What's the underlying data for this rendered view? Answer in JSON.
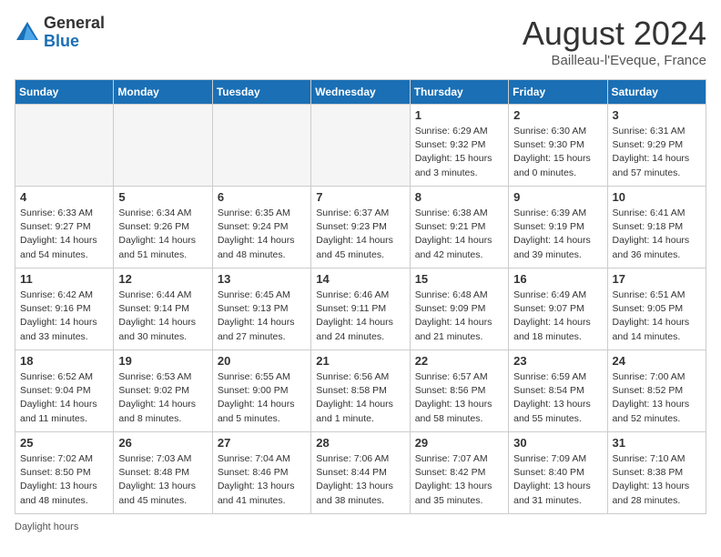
{
  "header": {
    "logo_general": "General",
    "logo_blue": "Blue",
    "month_year": "August 2024",
    "location": "Bailleau-l'Eveque, France"
  },
  "weekdays": [
    "Sunday",
    "Monday",
    "Tuesday",
    "Wednesday",
    "Thursday",
    "Friday",
    "Saturday"
  ],
  "weeks": [
    [
      {
        "day": "",
        "info": ""
      },
      {
        "day": "",
        "info": ""
      },
      {
        "day": "",
        "info": ""
      },
      {
        "day": "",
        "info": ""
      },
      {
        "day": "1",
        "info": "Sunrise: 6:29 AM\nSunset: 9:32 PM\nDaylight: 15 hours\nand 3 minutes."
      },
      {
        "day": "2",
        "info": "Sunrise: 6:30 AM\nSunset: 9:30 PM\nDaylight: 15 hours\nand 0 minutes."
      },
      {
        "day": "3",
        "info": "Sunrise: 6:31 AM\nSunset: 9:29 PM\nDaylight: 14 hours\nand 57 minutes."
      }
    ],
    [
      {
        "day": "4",
        "info": "Sunrise: 6:33 AM\nSunset: 9:27 PM\nDaylight: 14 hours\nand 54 minutes."
      },
      {
        "day": "5",
        "info": "Sunrise: 6:34 AM\nSunset: 9:26 PM\nDaylight: 14 hours\nand 51 minutes."
      },
      {
        "day": "6",
        "info": "Sunrise: 6:35 AM\nSunset: 9:24 PM\nDaylight: 14 hours\nand 48 minutes."
      },
      {
        "day": "7",
        "info": "Sunrise: 6:37 AM\nSunset: 9:23 PM\nDaylight: 14 hours\nand 45 minutes."
      },
      {
        "day": "8",
        "info": "Sunrise: 6:38 AM\nSunset: 9:21 PM\nDaylight: 14 hours\nand 42 minutes."
      },
      {
        "day": "9",
        "info": "Sunrise: 6:39 AM\nSunset: 9:19 PM\nDaylight: 14 hours\nand 39 minutes."
      },
      {
        "day": "10",
        "info": "Sunrise: 6:41 AM\nSunset: 9:18 PM\nDaylight: 14 hours\nand 36 minutes."
      }
    ],
    [
      {
        "day": "11",
        "info": "Sunrise: 6:42 AM\nSunset: 9:16 PM\nDaylight: 14 hours\nand 33 minutes."
      },
      {
        "day": "12",
        "info": "Sunrise: 6:44 AM\nSunset: 9:14 PM\nDaylight: 14 hours\nand 30 minutes."
      },
      {
        "day": "13",
        "info": "Sunrise: 6:45 AM\nSunset: 9:13 PM\nDaylight: 14 hours\nand 27 minutes."
      },
      {
        "day": "14",
        "info": "Sunrise: 6:46 AM\nSunset: 9:11 PM\nDaylight: 14 hours\nand 24 minutes."
      },
      {
        "day": "15",
        "info": "Sunrise: 6:48 AM\nSunset: 9:09 PM\nDaylight: 14 hours\nand 21 minutes."
      },
      {
        "day": "16",
        "info": "Sunrise: 6:49 AM\nSunset: 9:07 PM\nDaylight: 14 hours\nand 18 minutes."
      },
      {
        "day": "17",
        "info": "Sunrise: 6:51 AM\nSunset: 9:05 PM\nDaylight: 14 hours\nand 14 minutes."
      }
    ],
    [
      {
        "day": "18",
        "info": "Sunrise: 6:52 AM\nSunset: 9:04 PM\nDaylight: 14 hours\nand 11 minutes."
      },
      {
        "day": "19",
        "info": "Sunrise: 6:53 AM\nSunset: 9:02 PM\nDaylight: 14 hours\nand 8 minutes."
      },
      {
        "day": "20",
        "info": "Sunrise: 6:55 AM\nSunset: 9:00 PM\nDaylight: 14 hours\nand 5 minutes."
      },
      {
        "day": "21",
        "info": "Sunrise: 6:56 AM\nSunset: 8:58 PM\nDaylight: 14 hours\nand 1 minute."
      },
      {
        "day": "22",
        "info": "Sunrise: 6:57 AM\nSunset: 8:56 PM\nDaylight: 13 hours\nand 58 minutes."
      },
      {
        "day": "23",
        "info": "Sunrise: 6:59 AM\nSunset: 8:54 PM\nDaylight: 13 hours\nand 55 minutes."
      },
      {
        "day": "24",
        "info": "Sunrise: 7:00 AM\nSunset: 8:52 PM\nDaylight: 13 hours\nand 52 minutes."
      }
    ],
    [
      {
        "day": "25",
        "info": "Sunrise: 7:02 AM\nSunset: 8:50 PM\nDaylight: 13 hours\nand 48 minutes."
      },
      {
        "day": "26",
        "info": "Sunrise: 7:03 AM\nSunset: 8:48 PM\nDaylight: 13 hours\nand 45 minutes."
      },
      {
        "day": "27",
        "info": "Sunrise: 7:04 AM\nSunset: 8:46 PM\nDaylight: 13 hours\nand 41 minutes."
      },
      {
        "day": "28",
        "info": "Sunrise: 7:06 AM\nSunset: 8:44 PM\nDaylight: 13 hours\nand 38 minutes."
      },
      {
        "day": "29",
        "info": "Sunrise: 7:07 AM\nSunset: 8:42 PM\nDaylight: 13 hours\nand 35 minutes."
      },
      {
        "day": "30",
        "info": "Sunrise: 7:09 AM\nSunset: 8:40 PM\nDaylight: 13 hours\nand 31 minutes."
      },
      {
        "day": "31",
        "info": "Sunrise: 7:10 AM\nSunset: 8:38 PM\nDaylight: 13 hours\nand 28 minutes."
      }
    ]
  ],
  "footer": {
    "daylight_label": "Daylight hours"
  }
}
